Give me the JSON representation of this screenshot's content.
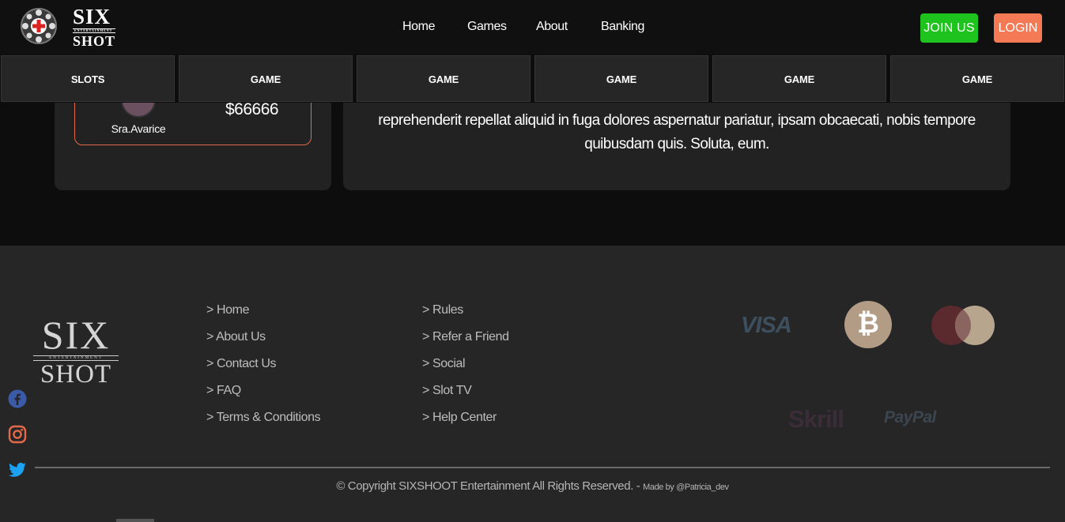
{
  "header": {
    "logo_top": "SIX",
    "logo_mid": "ENTERTAINMENT",
    "logo_bottom": "SHOT",
    "nav": [
      "Home",
      "Games",
      "About",
      "Banking"
    ],
    "join_label": "JOIN US",
    "login_label": "LOGIN"
  },
  "categories": [
    "SLOTS",
    "GAME",
    "GAME",
    "GAME",
    "GAME",
    "GAME"
  ],
  "winner": {
    "name": "Sra.Avarice",
    "amount": "$66666"
  },
  "description": "reprehenderit repellat aliquid in fuga dolores aspernatur pariatur, ipsam obcaecati, nobis tempore quibusdam quis. Soluta, eum.",
  "footer": {
    "logo_top": "SIX",
    "logo_mid": "ENTERTAINMENT",
    "logo_bottom": "SHOT",
    "col1": [
      "> Home",
      "> About Us",
      "> Contact Us",
      "> FAQ",
      "> Terms & Conditions"
    ],
    "col2": [
      "> Rules",
      "> Refer a Friend",
      "> Social",
      "> Slot TV",
      "> Help Center"
    ],
    "payments": {
      "visa": "VISA",
      "bitcoin": "₿",
      "skrill": "Skrill",
      "paypal": "PayPal"
    },
    "copyright": "© Copyright SIXSHOOT Entertainment All Rights Reserved. - ",
    "made_by": "Made by @Patricia_dev"
  },
  "colors": {
    "join": "#1ec31e",
    "login": "#f37a55",
    "accent_border": "#e2694a",
    "facebook": "#3b5ba9",
    "instagram": "#e2694a",
    "twitter": "#1da1f2"
  },
  "icons": [
    "facebook-icon",
    "instagram-icon",
    "twitter-icon",
    "mastercard-icon",
    "bitcoin-icon",
    "casino-chip-icon"
  ]
}
